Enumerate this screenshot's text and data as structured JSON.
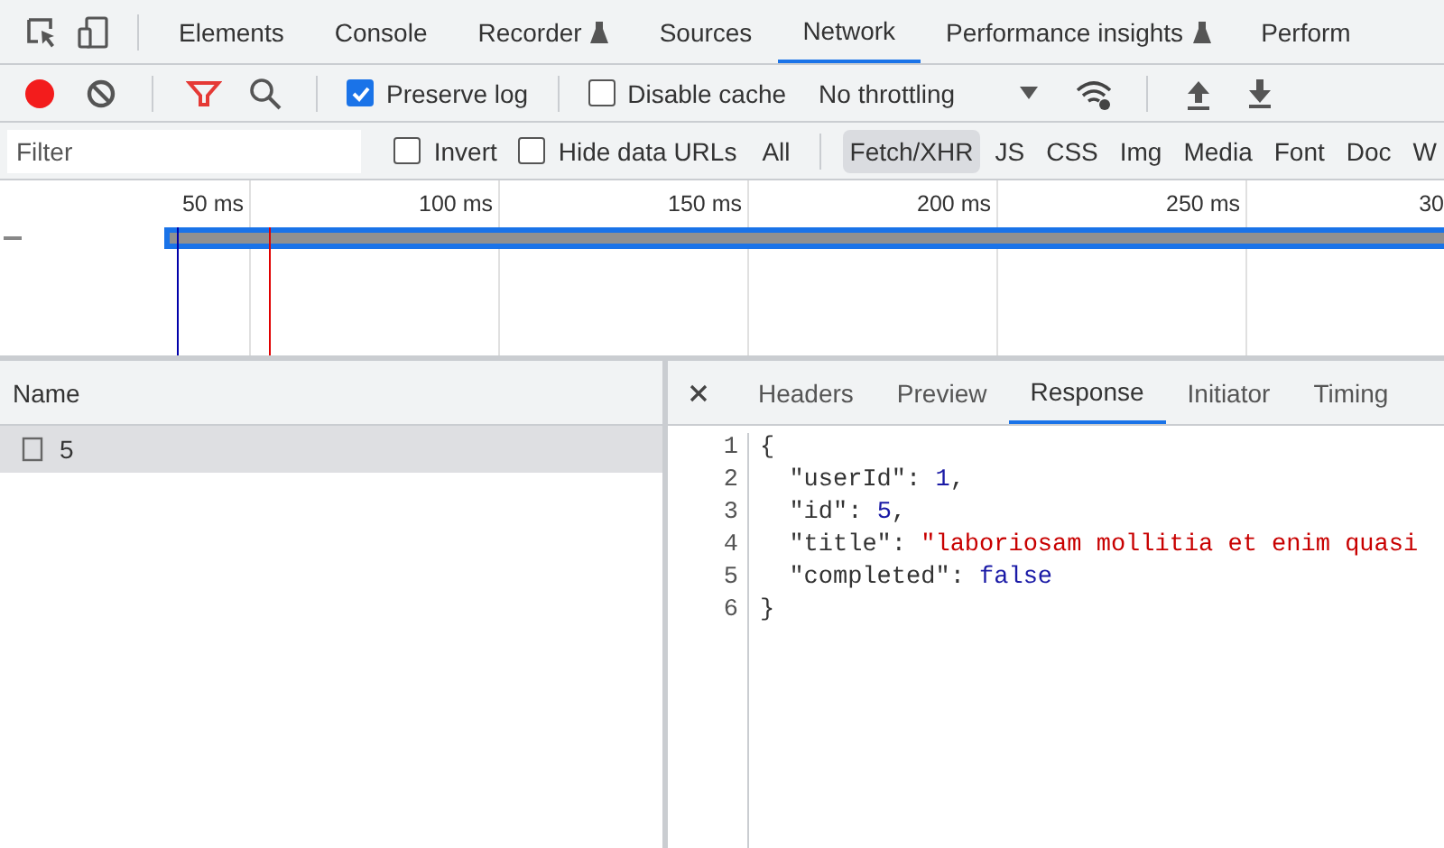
{
  "panel_tabs": [
    {
      "label": "Elements",
      "selected": false,
      "experimental": false
    },
    {
      "label": "Console",
      "selected": false,
      "experimental": false
    },
    {
      "label": "Recorder",
      "selected": false,
      "experimental": true
    },
    {
      "label": "Sources",
      "selected": false,
      "experimental": false
    },
    {
      "label": "Network",
      "selected": true,
      "experimental": false
    },
    {
      "label": "Performance insights",
      "selected": false,
      "experimental": true
    },
    {
      "label": "Perform",
      "selected": false,
      "experimental": false
    }
  ],
  "toolbar": {
    "recording": true,
    "preserve_log": {
      "label": "Preserve log",
      "checked": true
    },
    "disable_cache": {
      "label": "Disable cache",
      "checked": false
    },
    "throttling": "No throttling"
  },
  "filter_bar": {
    "placeholder": "Filter",
    "invert": {
      "label": "Invert",
      "checked": false
    },
    "hide_data_urls": {
      "label": "Hide data URLs",
      "checked": false
    },
    "types": [
      {
        "label": "All",
        "selected": false
      },
      {
        "label": "Fetch/XHR",
        "selected": true
      },
      {
        "label": "JS",
        "selected": false
      },
      {
        "label": "CSS",
        "selected": false
      },
      {
        "label": "Img",
        "selected": false
      },
      {
        "label": "Media",
        "selected": false
      },
      {
        "label": "Font",
        "selected": false
      },
      {
        "label": "Doc",
        "selected": false
      },
      {
        "label": "W",
        "selected": false
      }
    ]
  },
  "timeline": {
    "ticks": [
      "50 ms",
      "100 ms",
      "150 ms",
      "200 ms",
      "250 ms",
      "30"
    ]
  },
  "requests": {
    "column": "Name",
    "rows": [
      {
        "name": "5",
        "selected": true
      }
    ]
  },
  "details": {
    "tabs": [
      {
        "label": "Headers",
        "selected": false
      },
      {
        "label": "Preview",
        "selected": false
      },
      {
        "label": "Response",
        "selected": true
      },
      {
        "label": "Initiator",
        "selected": false
      },
      {
        "label": "Timing",
        "selected": false
      }
    ],
    "lines": [
      {
        "number": "1",
        "tokens": [
          {
            "kind": "punct",
            "text": "{"
          }
        ]
      },
      {
        "number": "2",
        "tokens": [
          {
            "kind": "key",
            "text": "  \"userId\": "
          },
          {
            "kind": "number",
            "text": "1"
          },
          {
            "kind": "punct",
            "text": ","
          }
        ]
      },
      {
        "number": "3",
        "tokens": [
          {
            "kind": "key",
            "text": "  \"id\": "
          },
          {
            "kind": "number",
            "text": "5"
          },
          {
            "kind": "punct",
            "text": ","
          }
        ]
      },
      {
        "number": "4",
        "tokens": [
          {
            "kind": "key",
            "text": "  \"title\": "
          },
          {
            "kind": "string",
            "text": "\"laboriosam mollitia et enim quasi"
          }
        ]
      },
      {
        "number": "5",
        "tokens": [
          {
            "kind": "key",
            "text": "  \"completed\": "
          },
          {
            "kind": "keyword",
            "text": "false"
          }
        ]
      },
      {
        "number": "6",
        "tokens": [
          {
            "kind": "punct",
            "text": "}"
          }
        ]
      }
    ]
  }
}
